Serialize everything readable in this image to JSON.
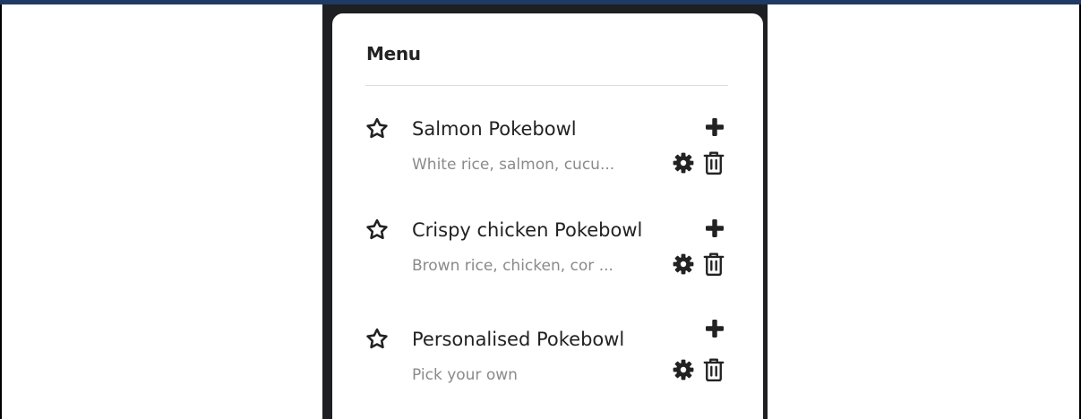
{
  "menu": {
    "title": "Menu",
    "items": [
      {
        "name": "Salmon Pokebowl",
        "description": "White rice, salmon, cucu..."
      },
      {
        "name": "Crispy chicken Pokebowl",
        "description": "Brown rice, chicken, cor ..."
      },
      {
        "name": "Personalised Pokebowl",
        "description": "Pick your own"
      }
    ]
  },
  "icons": {
    "favorite": "star-outline-icon",
    "add": "plus-icon",
    "settings": "gear-icon",
    "delete": "trash-icon"
  },
  "colors": {
    "top_bar": "#1f3a64",
    "panel_background": "#1e1f22",
    "card_background": "#ffffff",
    "primary_text": "#222222",
    "secondary_text": "#8a8a8a",
    "icon": "#222222"
  }
}
